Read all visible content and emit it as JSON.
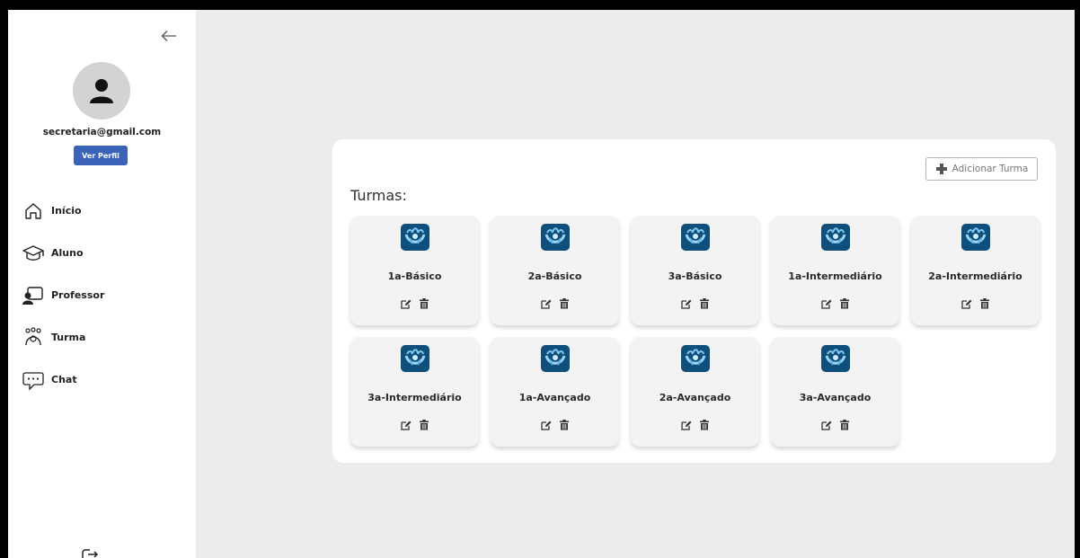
{
  "user": {
    "email": "secretaria@gmail.com",
    "profile_button": "Ver Perfil"
  },
  "sidebar": {
    "items": [
      {
        "label": "Início",
        "icon": "home-icon"
      },
      {
        "label": "Aluno",
        "icon": "graduation-cap-icon"
      },
      {
        "label": "Professor",
        "icon": "teacher-board-icon"
      },
      {
        "label": "Turma",
        "icon": "group-icon"
      },
      {
        "label": "Chat",
        "icon": "chat-icon"
      }
    ]
  },
  "main": {
    "title": "Turmas:",
    "add_button": "Adicionar Turma",
    "classes": [
      {
        "name": "1a-Básico"
      },
      {
        "name": "2a-Básico"
      },
      {
        "name": "3a-Básico"
      },
      {
        "name": "1a-Intermediário"
      },
      {
        "name": "2a-Intermediário"
      },
      {
        "name": "3a-Intermediário"
      },
      {
        "name": "1a-Avançado"
      },
      {
        "name": "2a-Avançado"
      },
      {
        "name": "3a-Avançado"
      }
    ]
  },
  "colors": {
    "accent": "#3b63b8",
    "background": "#ececec",
    "logo": "#0f4f7c"
  }
}
